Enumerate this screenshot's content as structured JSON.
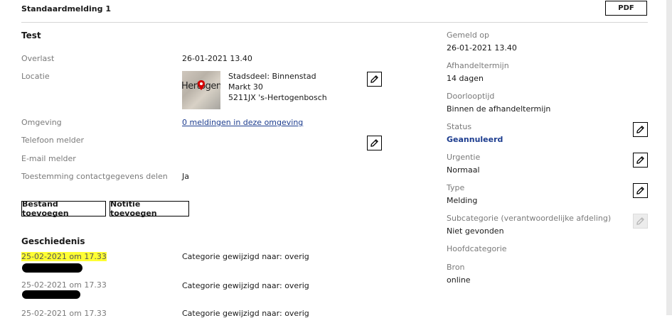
{
  "header": {
    "title": "Standaardmelding 1",
    "pdf_label": "PDF"
  },
  "main": {
    "title": "Test",
    "fields": {
      "overlast": {
        "label": "Overlast",
        "value": "26-01-2021 13.40"
      },
      "locatie": {
        "label": "Locatie",
        "map_text": "Hertogenbosch",
        "line1": "Stadsdeel: Binnenstad",
        "line2": "Markt 30",
        "line3": "5211JX 's-Hertogenbosch"
      },
      "omgeving": {
        "label": "Omgeving",
        "link": "0 meldingen in deze omgeving"
      },
      "telefoon": {
        "label": "Telefoon melder"
      },
      "email": {
        "label": "E-mail melder"
      },
      "toestemming": {
        "label": "Toestemming contactgegevens delen",
        "value": "Ja"
      }
    },
    "buttons": {
      "bestand": "Bestand toevoegen",
      "notitie": "Notitie toevoegen"
    }
  },
  "history": {
    "title": "Geschiedenis",
    "entries": [
      {
        "date": "25-02-2021 om 17.33",
        "text": "Categorie gewijzigd naar: overig",
        "highlighted": true
      },
      {
        "date": "25-02-2021 om 17.33",
        "text": "Categorie gewijzigd naar: overig",
        "highlighted": false
      },
      {
        "date": "25-02-2021 om 17.33",
        "text": "Categorie gewijzigd naar: overig",
        "highlighted": false
      }
    ]
  },
  "sidebar": {
    "gemeld_op": {
      "label": "Gemeld op",
      "value": "26-01-2021 13.40"
    },
    "afhandeltermijn": {
      "label": "Afhandeltermijn",
      "value": "14 dagen"
    },
    "doorlooptijd": {
      "label": "Doorlooptijd",
      "value": "Binnen de afhandeltermijn"
    },
    "status": {
      "label": "Status",
      "value": "Geannuleerd"
    },
    "urgentie": {
      "label": "Urgentie",
      "value": "Normaal"
    },
    "type": {
      "label": "Type",
      "value": "Melding"
    },
    "subcategorie": {
      "label": "Subcategorie (verantwoordelijke afdeling)",
      "value": "Niet gevonden"
    },
    "hoofdcategorie": {
      "label": "Hoofdcategorie",
      "value": ""
    },
    "bron": {
      "label": "Bron",
      "value": "online"
    }
  },
  "colors": {
    "status_value": "#1d3d8f",
    "highlight": "#ffff33",
    "link": "#1d3d8f",
    "map_pin": "#d40000"
  },
  "icons": {
    "edit": "pencil-icon",
    "location": "map-pin-icon"
  }
}
